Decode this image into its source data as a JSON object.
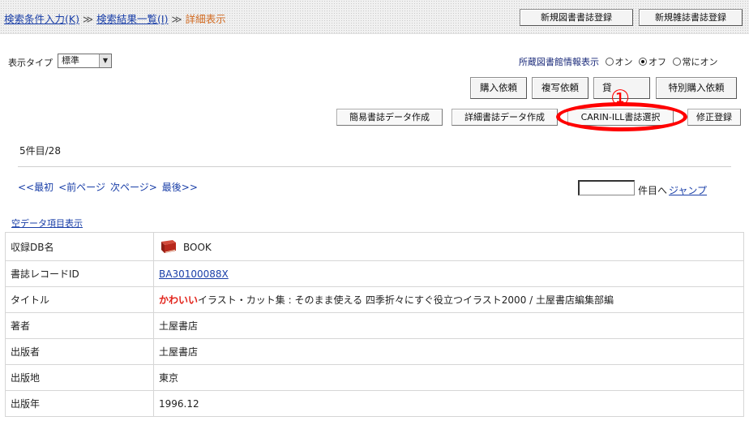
{
  "breadcrumb": {
    "search_input": "検索条件入力(K)",
    "sep1": "≫",
    "result_list": "検索結果一覧(I)",
    "sep2": "≫",
    "current": "詳細表示"
  },
  "header_buttons": {
    "new_book": "新規図書書誌登録",
    "new_magazine": "新規雑誌書誌登録"
  },
  "display_type": {
    "label": "表示タイプ",
    "selected": "標準"
  },
  "holdings_display": {
    "label": "所蔵図書館情報表示",
    "options": [
      "オン",
      "オフ",
      "常にオン"
    ],
    "selected": "オフ"
  },
  "action_buttons": {
    "purchase": "購入依頼",
    "copy": "複写依頼",
    "loan": "貸",
    "special_purchase": "特別購入依頼",
    "simple_create": "簡易書誌データ作成",
    "detail_create": "詳細書誌データ作成",
    "carin_ill": "CARIN-ILL書誌選択",
    "fix_register": "修正登録"
  },
  "annotation": {
    "number": "①",
    "color": "#ff0000"
  },
  "record_count": "5件目/28",
  "pager": {
    "first": "<<最初",
    "prev": "<前ページ",
    "next": "次ページ>",
    "last": "最後>>"
  },
  "jump": {
    "value": "",
    "suffix": "件目へ",
    "link": "ジャンプ"
  },
  "empty_items_link": "空データ項目表示",
  "details": {
    "db_name": {
      "key": "収録DB名",
      "value": "BOOK",
      "icon": "book-icon"
    },
    "record_id": {
      "key": "書誌レコードID",
      "value": "BA30100088X"
    },
    "title": {
      "key": "タイトル",
      "highlight": "かわいい",
      "rest": "イラスト・カット集 : そのまま使える 四季折々にすぐ役立つイラスト2000 / 土屋書店編集部編"
    },
    "author": {
      "key": "著者",
      "value": "土屋書店"
    },
    "publisher": {
      "key": "出版者",
      "value": "土屋書店"
    },
    "place": {
      "key": "出版地",
      "value": "東京"
    },
    "year": {
      "key": "出版年",
      "value": "1996.12"
    }
  }
}
